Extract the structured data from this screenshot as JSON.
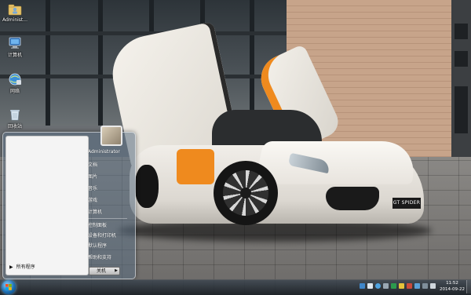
{
  "desktop": {
    "icons": [
      {
        "name": "administrator-folder-icon",
        "label": "Administ..."
      },
      {
        "name": "computer-icon",
        "label": "计算机"
      },
      {
        "name": "network-icon",
        "label": "网络"
      },
      {
        "name": "recycle-bin-icon",
        "label": "回收站"
      }
    ]
  },
  "wallpaper": {
    "plate_text": "GT SPIDER"
  },
  "start_menu": {
    "all_programs": "所有程序",
    "right_items": [
      "Administrator",
      "文档",
      "图片",
      "音乐",
      "游戏",
      "计算机",
      "控制面板",
      "设备和打印机",
      "默认程序",
      "帮助和支持"
    ],
    "shutdown_label": "关机"
  },
  "taskbar": {
    "clock_time": "11:52",
    "clock_date": "2014-09-22"
  },
  "colors": {
    "accent_orange": "#ef8a1e",
    "taskbar": "#1d2228",
    "start_orb": "#1d6fb3"
  }
}
